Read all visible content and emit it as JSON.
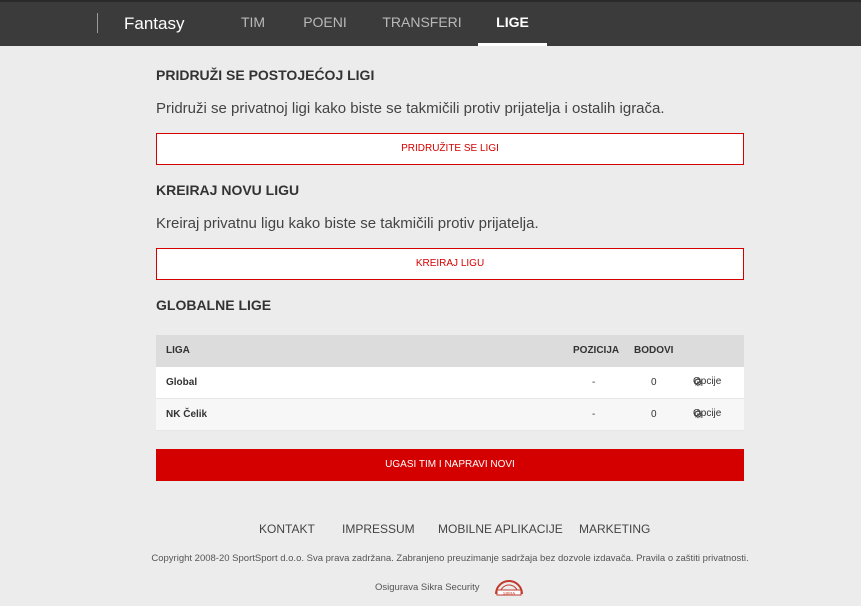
{
  "header": {
    "brand": "Fantasy",
    "nav": [
      {
        "label": "TIM",
        "active": false
      },
      {
        "label": "POENI",
        "active": false
      },
      {
        "label": "TRANSFERI",
        "active": false
      },
      {
        "label": "LIGE",
        "active": true
      }
    ]
  },
  "join": {
    "title": "PRIDRUŽI SE POSTOJEĆOJ LIGI",
    "description": "Pridruži se privatnoj ligi kako biste se takmičili protiv prijatelja i ostalih igrača.",
    "button": "PRIDRUŽITE SE LIGI"
  },
  "create": {
    "title": "KREIRAJ NOVU LIGU",
    "description": "Kreiraj privatnu ligu kako biste se takmičili protiv prijatelja.",
    "button": "KREIRAJ LIGU"
  },
  "global": {
    "title": "GLOBALNE LIGE",
    "columns": {
      "league": "LIGA",
      "position": "POZICIJA",
      "points": "BODOVI"
    },
    "rows": [
      {
        "name": "Global",
        "position": "-",
        "points": "0",
        "options": "Opcije"
      },
      {
        "name": "NK Čelik",
        "position": "-",
        "points": "0",
        "options": "Opcije"
      }
    ]
  },
  "reset_button": "UGASI TIM I NAPRAVI NOVI",
  "footer": {
    "links": [
      "KONTAKT",
      "IMPRESSUM",
      "MOBILNE APLIKACIJE",
      "MARKETING"
    ],
    "copyright": "Copyright 2008-20 SportSport d.o.o. Sva prava zadržana. Zabranjeno preuzimanje sadržaja bez dozvole izdavača. Pravila o zaštiti privatnosti.",
    "secured_by": "Osigurava Sikra Security",
    "seal_text": "SIKRA"
  },
  "colors": {
    "accent": "#d40000",
    "header_bg": "#3b3b3b",
    "page_bg": "#ececec"
  },
  "icons": {
    "options": "gear-icon"
  }
}
